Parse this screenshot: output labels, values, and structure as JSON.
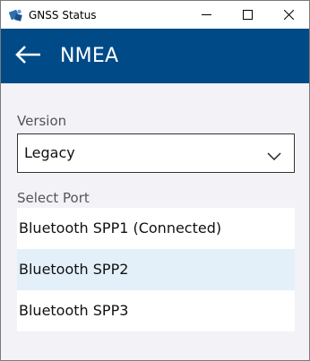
{
  "window": {
    "title": "GNSS Status",
    "app_icon": "gnss-app-icon",
    "controls": [
      "minimize-icon",
      "maximize-icon",
      "close-icon"
    ]
  },
  "header": {
    "back_icon": "back-arrow-icon",
    "title": "NMEA",
    "background_color": "#004a87"
  },
  "version": {
    "label": "Version",
    "selected": "Legacy",
    "chevron_icon": "chevron-down-icon"
  },
  "port": {
    "label": "Select Port",
    "items": [
      {
        "label": "Bluetooth SPP1 (Connected)",
        "selected": false
      },
      {
        "label": "Bluetooth SPP2",
        "selected": true
      },
      {
        "label": "Bluetooth SPP3",
        "selected": false
      }
    ],
    "selected_color": "#e3f0f9"
  }
}
